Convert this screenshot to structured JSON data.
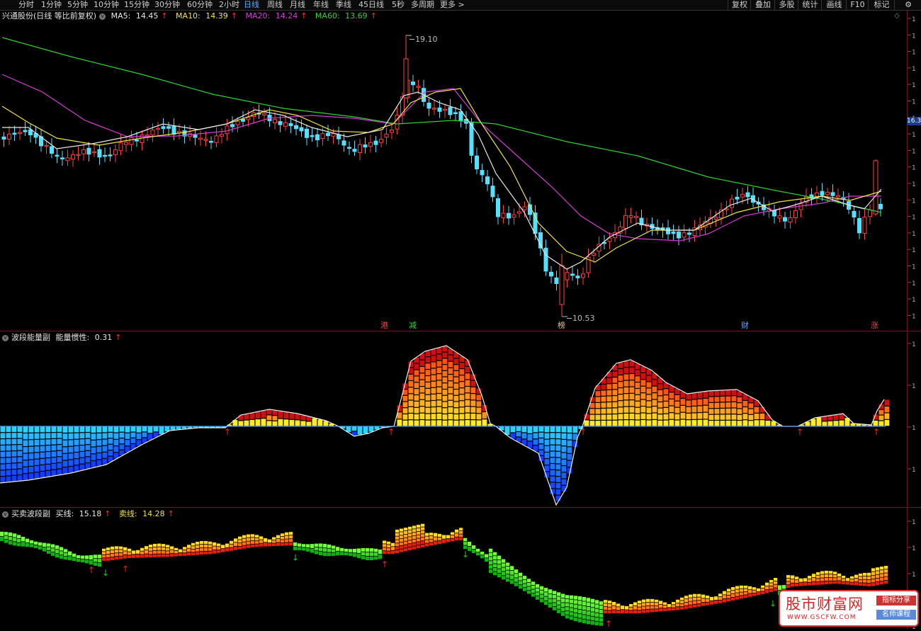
{
  "toolbar": {
    "periods": [
      "分时",
      "1分钟",
      "5分钟",
      "10分钟",
      "15分钟",
      "30分钟",
      "60分钟",
      "2小时",
      "日线",
      "周线",
      "月线",
      "年线",
      "季线",
      "45日线",
      "5秒",
      "多周期",
      "更多 >"
    ],
    "active_period": "日线",
    "right_buttons": [
      "复权",
      "叠加",
      "多股",
      "统计",
      "画线",
      "F10",
      "标记",
      "⚙"
    ]
  },
  "main_pane": {
    "stock_title": "兴通股份(日线 等比前复权)",
    "ma5": {
      "label": "MA5:",
      "value": "14.45",
      "arrow": "↑",
      "color": "#e8e8e8"
    },
    "ma10": {
      "label": "MA10:",
      "value": "14.39",
      "arrow": "↑",
      "color": "#f2e24a"
    },
    "ma20": {
      "label": "MA20:",
      "value": "14.24",
      "arrow": "↑",
      "color": "#d53ad5"
    },
    "ma60": {
      "label": "MA60:",
      "value": "13.69",
      "arrow": "↑",
      "color": "#2fd02f"
    },
    "high_label": "19.10",
    "low_label": "10.53",
    "price_badge": "16.3",
    "event_tags": [
      {
        "text": "港",
        "color": "#e84848"
      },
      {
        "text": "减",
        "color": "#40d040"
      },
      {
        "text": "榜",
        "color": "#e8c080"
      },
      {
        "text": "财",
        "color": "#60a8ff"
      },
      {
        "text": "涨",
        "color": "#e84848"
      }
    ]
  },
  "energy_pane": {
    "name": "波段能量副",
    "metric_label": "能量惯性:",
    "metric_value": "0.31",
    "arrow": "↑"
  },
  "trade_pane": {
    "name": "买卖波段副",
    "buy_label": "买线:",
    "buy_value": "15.18",
    "sell_label": "卖线:",
    "sell_value": "14.28",
    "arrow": "↑"
  },
  "watermark": {
    "title": "股市财富网",
    "url": "WWW.GSCFW.COM",
    "badge_top": "指标分享",
    "badge_bottom": "名师课程"
  },
  "colors": {
    "up_candle": "#ff4040",
    "down_candle": "#54e0ff",
    "separator": "#7a1010",
    "buy_arrow": "#ff2020",
    "sell_arrow": "#20d020"
  }
}
